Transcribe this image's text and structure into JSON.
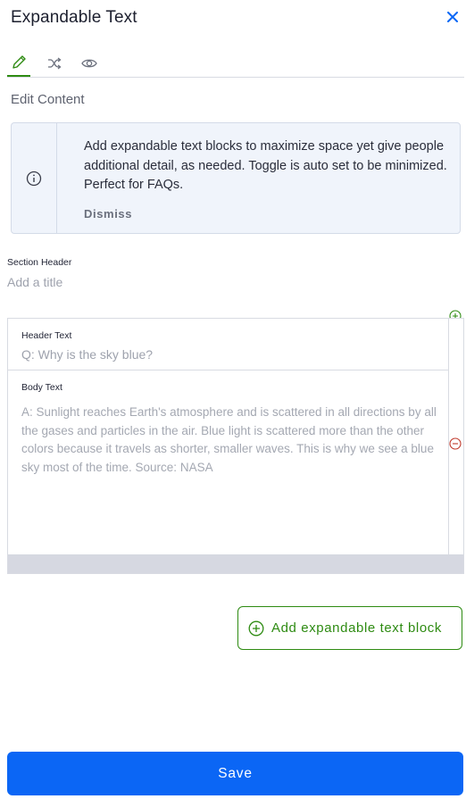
{
  "header": {
    "title": "Expandable Text",
    "close_icon": "close-icon"
  },
  "tabs": [
    {
      "name": "edit",
      "icon": "pencil-icon",
      "active": true
    },
    {
      "name": "shuffle",
      "icon": "shuffle-icon",
      "active": false
    },
    {
      "name": "preview",
      "icon": "eye-icon",
      "active": false
    }
  ],
  "edit_content_label": "Edit Content",
  "info_box": {
    "icon": "info-icon",
    "text": "Add expandable text blocks to maximize space yet give people additional detail, as needed. Toggle is auto set to be minimized. Perfect for FAQs.",
    "dismiss_label": "Dismiss"
  },
  "section_header": {
    "label": "Section Header",
    "placeholder": "Add a title",
    "value": ""
  },
  "block": {
    "header_label": "Header Text",
    "header_placeholder": "Q: Why is the sky blue?",
    "body_label": "Body Text",
    "body_placeholder": "A: Sunlight reaches Earth's atmosphere and is scattered in all directions by all the gases and particles in the air. Blue light is scattered more than the other colors because it travels as shorter, smaller waves. This is why we see a blue sky most of the time. Source: NASA"
  },
  "add_block_label": "Add expandable text block",
  "save_label": "Save",
  "colors": {
    "accent_green": "#2e8b12",
    "primary_blue": "#0b66f5",
    "remove_red": "#c0392b"
  }
}
